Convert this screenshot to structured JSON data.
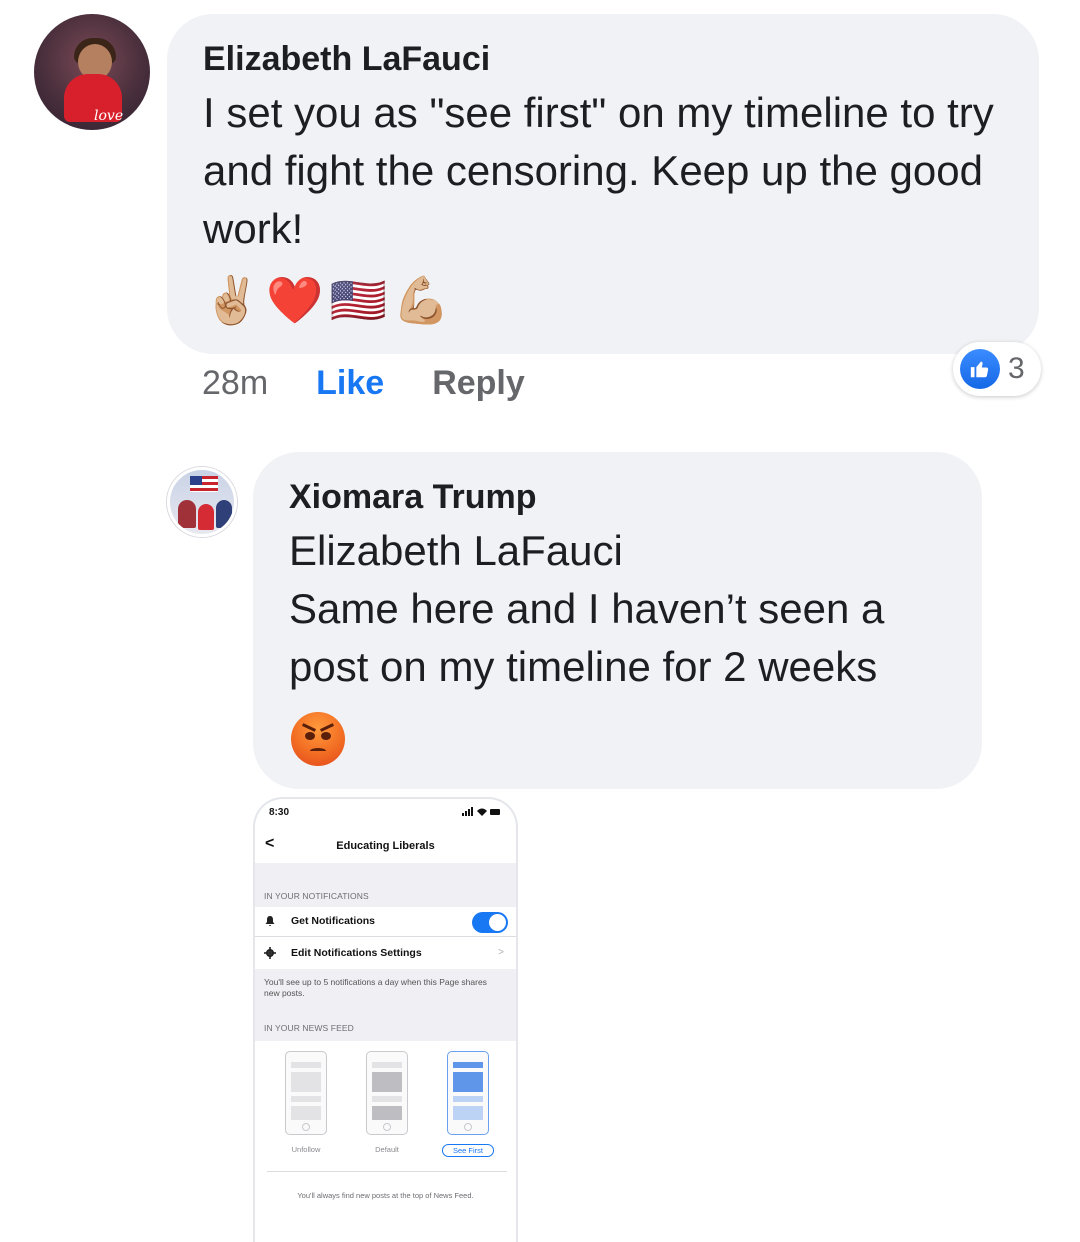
{
  "comment": {
    "author": "Elizabeth LaFauci",
    "text": "I set you as \"see first\" on my timeline to try and fight the censoring. Keep up the good work!",
    "emojis": [
      "✌🏼",
      "❤️",
      "🇺🇸",
      "💪🏼"
    ],
    "avatar_signature": "love",
    "time": "28m",
    "like_label": "Like",
    "reply_label": "Reply",
    "reaction_count": "3"
  },
  "reply": {
    "author": "Xiomara Trump",
    "mention": "Elizabeth LaFauci",
    "text": "Same here and I haven’t seen a post on my timeline for 2 weeks",
    "emoji_icon": "angry-face-icon"
  },
  "attachment": {
    "status_time": "8:30",
    "status_icons": "signal wifi battery",
    "nav_back": "<",
    "page_title": "Educating Liberals",
    "section_notifications": "IN YOUR NOTIFICATIONS",
    "get_notifications": "Get Notifications",
    "get_notifications_on": true,
    "edit_notifications": "Edit Notifications Settings",
    "notifications_note": "You'll see up to 5 notifications a day when this Page shares new posts.",
    "section_news_feed": "IN YOUR NEWS FEED",
    "options": [
      "Unfollow",
      "Default",
      "See First"
    ],
    "selected_option": "See First",
    "footer_note": "You'll always find new posts at the top of News Feed."
  },
  "colors": {
    "bubble": "#f0f2f5",
    "link_blue": "#1877f2",
    "muted": "#65676b"
  }
}
